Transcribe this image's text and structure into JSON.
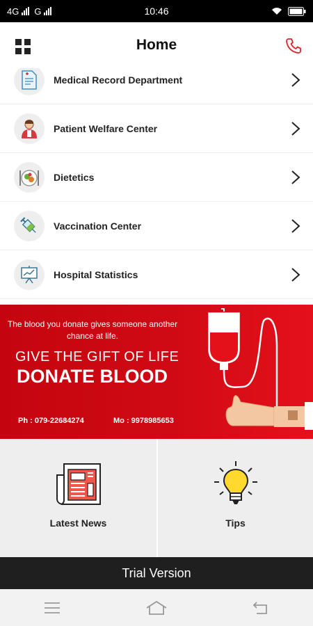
{
  "status_bar": {
    "network_1": "4G",
    "network_2": "G",
    "time": "10:46"
  },
  "header": {
    "title": "Home",
    "menu_icon": "grid-icon",
    "call_icon": "phone-icon",
    "call_color": "#e0232b"
  },
  "menu_items": [
    {
      "label": "Medical Record Department",
      "icon": "medical-record-icon"
    },
    {
      "label": "Patient Welfare Center",
      "icon": "patient-welfare-icon"
    },
    {
      "label": "Dietetics",
      "icon": "dietetics-icon"
    },
    {
      "label": "Vaccination Center",
      "icon": "syringe-icon"
    },
    {
      "label": "Hospital Statistics",
      "icon": "statistics-board-icon"
    }
  ],
  "banner": {
    "subtitle": "The blood you donate gives someone another chance at life.",
    "heading_line1": "GIVE THE GIFT OF LIFE",
    "heading_line2": "DONATE BLOOD",
    "phone": "Ph : 079-22684274",
    "mobile": "Mo : 9978985653",
    "color": "#d00a14"
  },
  "tiles": [
    {
      "label": "Latest News",
      "icon": "newspaper-icon"
    },
    {
      "label": "Tips",
      "icon": "lightbulb-icon"
    }
  ],
  "footer": {
    "trial_text": "Trial Version"
  },
  "nav": {
    "menu_icon": "menu-lines-icon",
    "home_icon": "home-icon",
    "back_icon": "back-icon"
  }
}
